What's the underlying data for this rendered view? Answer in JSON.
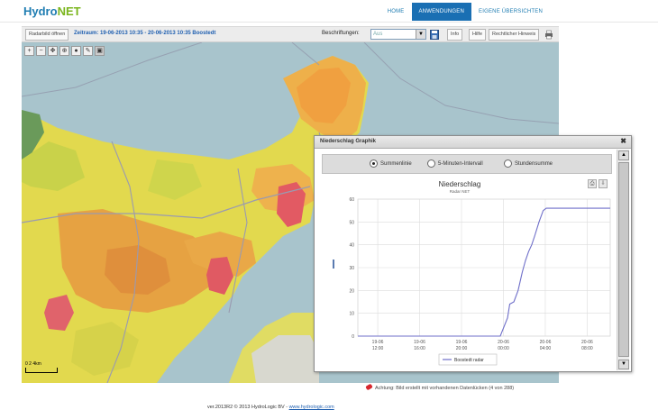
{
  "header": {
    "logo_part1": "Hydro",
    "logo_part2": "NET",
    "nav": [
      {
        "label": "HOME",
        "active": false
      },
      {
        "label": "ANWENDUNGEN",
        "active": true
      },
      {
        "label": "EIGENE ÜBERSICHTEN",
        "active": false
      }
    ]
  },
  "toolbar": {
    "radarbild_label": "Radarbild öffnen",
    "zeitraum_text": "Zeitraum: 19-06-2013 10:35 - 20-06-2013 10:35  Boostedt",
    "beschriftungen_label": "Beschriftungen:",
    "beschriftungen_value": "Aus",
    "info_label": "Info",
    "hilfe_label": "Hilfe",
    "rechtlicher_label": "Rechtlicher Hinweis"
  },
  "map": {
    "tool_icons": [
      "zoom-in-icon",
      "zoom-out-icon",
      "pan-icon",
      "zoom-box-icon",
      "location-icon",
      "measure-icon",
      "graph-select-icon"
    ],
    "scale_text": "0 2 4km"
  },
  "popup": {
    "title": "Niederschlag Graphik",
    "radio_options": [
      {
        "label": "Summenlinie",
        "checked": true
      },
      {
        "label": "5-Minuten-Intervall",
        "checked": false
      },
      {
        "label": "Stundensumme",
        "checked": false
      }
    ]
  },
  "chart_data": {
    "type": "line",
    "title": "Niederschlag",
    "subtitle": "Radar NET",
    "ylabel": "",
    "ylim": [
      0,
      60
    ],
    "y_ticks": [
      "0",
      "10",
      "20",
      "30",
      "40",
      "50",
      "60"
    ],
    "x_ticks": [
      {
        "l1": "19-06",
        "l2": "12:00"
      },
      {
        "l1": "19-06",
        "l2": "16:00"
      },
      {
        "l1": "19-06",
        "l2": "20:00"
      },
      {
        "l1": "20-06",
        "l2": "00:00"
      },
      {
        "l1": "20-06",
        "l2": "04:00"
      },
      {
        "l1": "20-06",
        "l2": "08:00"
      }
    ],
    "x_hours": [
      0,
      4,
      8,
      12,
      16,
      20
    ],
    "xlim_hours": [
      -1.9,
      22.2
    ],
    "series": [
      {
        "name": "Boostedt radar",
        "color": "#6f6fc9",
        "points": [
          [
            -1.9,
            0
          ],
          [
            11.7,
            0
          ],
          [
            12.4,
            8
          ],
          [
            12.6,
            14
          ],
          [
            13.0,
            15
          ],
          [
            13.4,
            20
          ],
          [
            13.8,
            28
          ],
          [
            14.1,
            33
          ],
          [
            14.4,
            37
          ],
          [
            14.7,
            40
          ],
          [
            15.0,
            44
          ],
          [
            15.4,
            50
          ],
          [
            15.8,
            55
          ],
          [
            16.1,
            56
          ],
          [
            22.2,
            56
          ]
        ]
      }
    ],
    "legend_placement": "bottom-center",
    "grid": true
  },
  "note": "Achtung: Bild erstellt mit vorhandenen Datenlücken (4 von 288)",
  "footer": {
    "text": "ver.2013R2 © 2013 HydroLogic BV - ",
    "link": "www.hydrologic.com"
  },
  "colors": {
    "brand_blue": "#1f7db2",
    "brand_green": "#7ab51d",
    "nav_active": "#1a6fb3",
    "series_line": "#6f6fc9"
  }
}
